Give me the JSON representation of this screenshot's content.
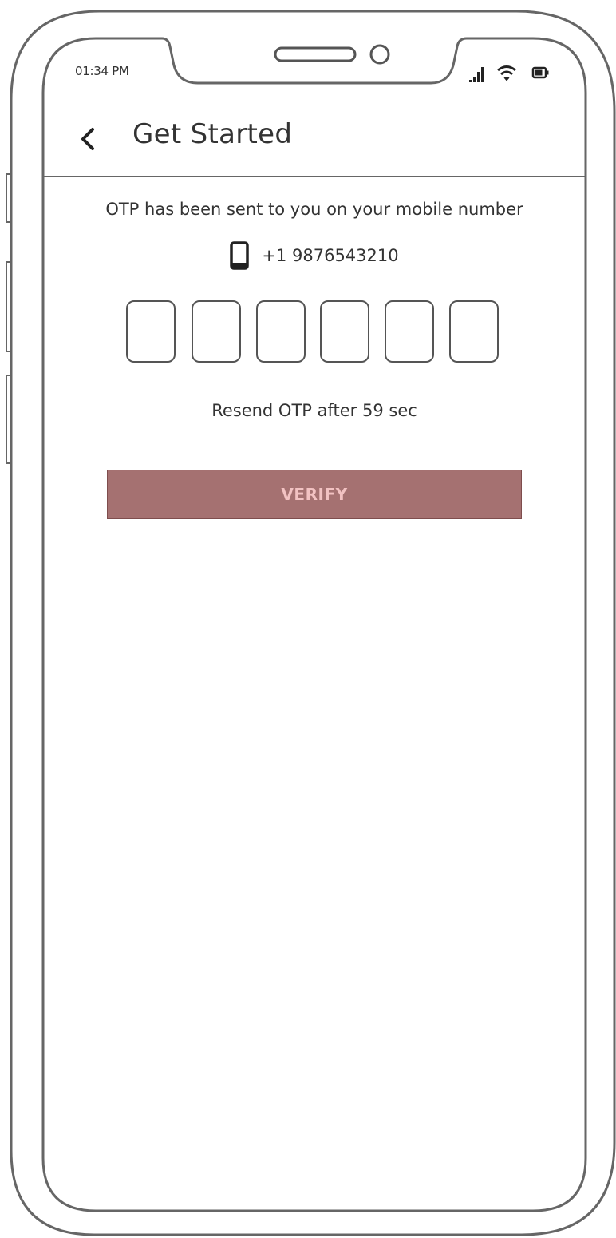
{
  "status_bar": {
    "time": "01:34 PM"
  },
  "header": {
    "title": "Get Started"
  },
  "otp": {
    "message": "OTP has been sent to you on your mobile number",
    "phone_number": "+1 9876543210",
    "box_count": 6,
    "digits": [
      "",
      "",
      "",
      "",
      "",
      ""
    ],
    "resend_text": "Resend OTP after 59 sec"
  },
  "actions": {
    "verify_label": "VERIFY"
  },
  "colors": {
    "verify_background": "#a57171",
    "verify_text": "#f2c2c2",
    "outline": "#555555"
  },
  "icons": {
    "back": "chevron-left-icon",
    "mobile": "mobile-phone-icon",
    "signal": "signal-icon",
    "wifi": "wifi-icon",
    "battery": "battery-icon"
  }
}
